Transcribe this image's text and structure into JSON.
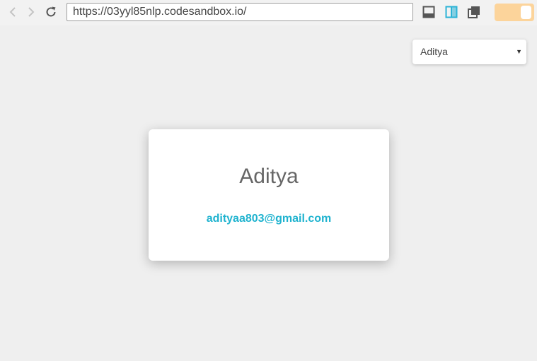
{
  "browser": {
    "url": "https://03yyl85nlp.codesandbox.io/",
    "icons": [
      "back-icon",
      "forward-icon",
      "reload-icon",
      "console-panel-icon",
      "split-view-icon",
      "gallery-icon"
    ],
    "toggle_color": "#fcd49b"
  },
  "select": {
    "selected": "Aditya"
  },
  "card": {
    "name": "Aditya",
    "email": "adityaa803@gmail.com",
    "email_color": "#1fb3cf"
  }
}
